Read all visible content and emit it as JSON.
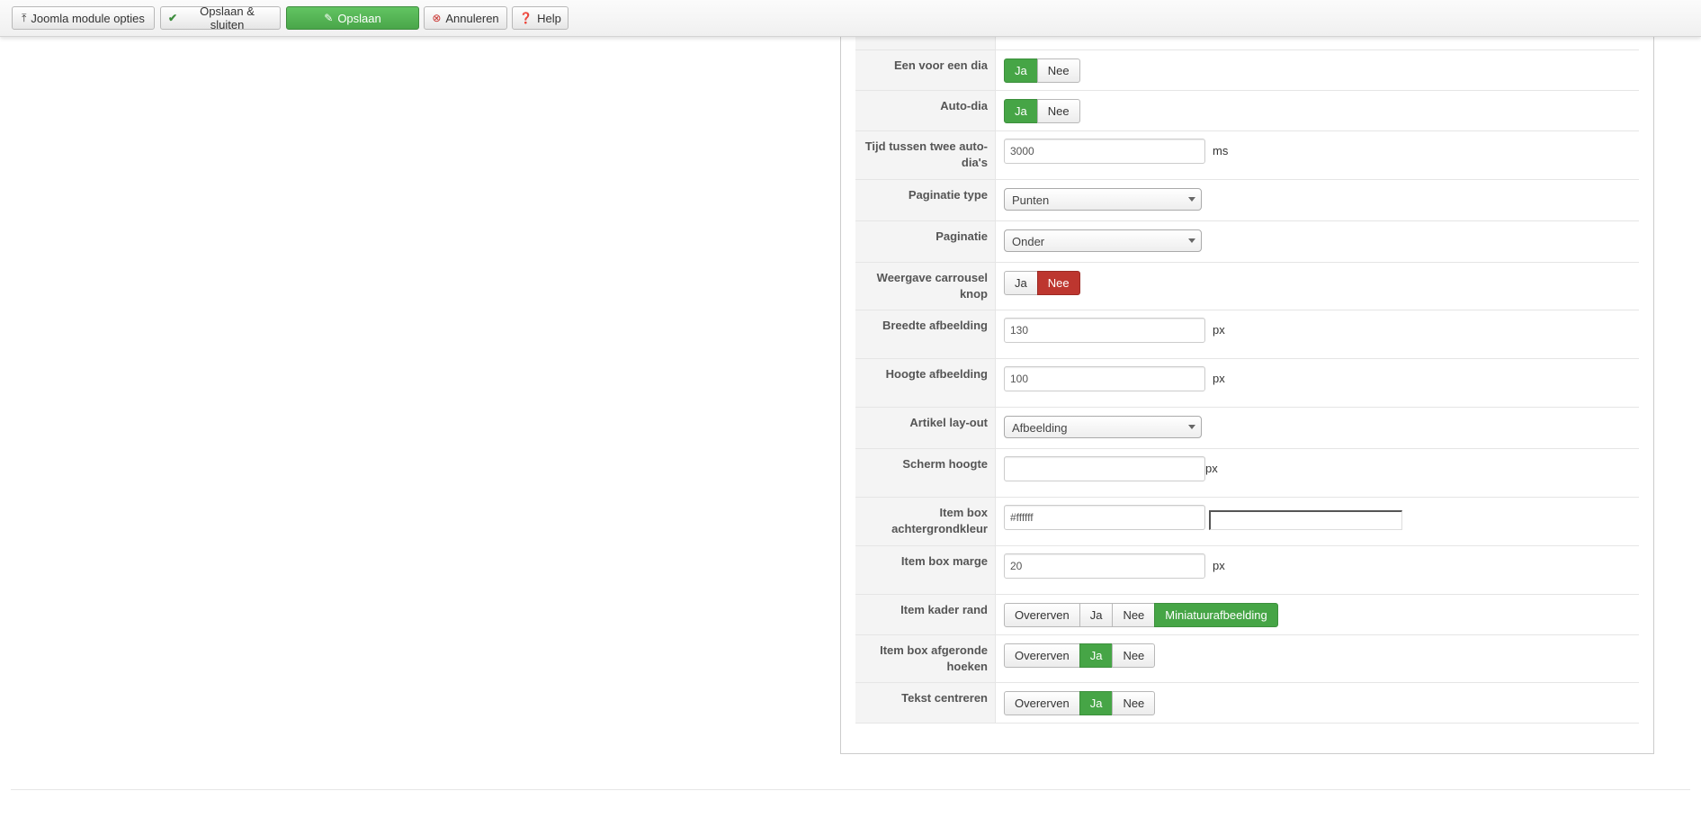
{
  "toolbar": {
    "buttons": [
      {
        "label": "Joomla module opties",
        "icon": "upload-icon"
      },
      {
        "label": "Opslaan & sluiten",
        "icon": "check-icon"
      },
      {
        "label": "Opslaan",
        "icon": "edit-icon"
      },
      {
        "label": "Annuleren",
        "icon": "cancel-icon"
      },
      {
        "label": "Help",
        "icon": "help-icon"
      }
    ]
  },
  "colors": {
    "toggle_on_green": "#46a546",
    "toggle_on_red": "#bd362f",
    "save_green": "#5bb75b"
  },
  "form": {
    "een_voor_een_dia": {
      "label": "Een voor een dia",
      "options": [
        "Ja",
        "Nee"
      ],
      "selected": "Ja"
    },
    "auto_dia": {
      "label": "Auto-dia",
      "options": [
        "Ja",
        "Nee"
      ],
      "selected": "Ja"
    },
    "tijd_tussen": {
      "label": "Tijd tussen twee auto-dia's",
      "value": "3000",
      "unit": "ms"
    },
    "paginatie_type": {
      "label": "Paginatie type",
      "value": "Punten"
    },
    "paginatie": {
      "label": "Paginatie",
      "value": "Onder"
    },
    "weergave_carrousel": {
      "label": "Weergave carrousel knop",
      "options": [
        "Ja",
        "Nee"
      ],
      "selected": "Nee"
    },
    "breedte_afbeelding": {
      "label": "Breedte afbeelding",
      "value": "130",
      "unit": "px"
    },
    "hoogte_afbeelding": {
      "label": "Hoogte afbeelding",
      "value": "100",
      "unit": "px"
    },
    "artikel_layout": {
      "label": "Artikel lay-out",
      "value": "Afbeelding"
    },
    "scherm_hoogte": {
      "label": "Scherm hoogte",
      "value": "",
      "unit": "px"
    },
    "item_box_achtergrondkleur": {
      "label": "Item box achtergrondkleur",
      "value": "#ffffff"
    },
    "item_box_marge": {
      "label": "Item box marge",
      "value": "20",
      "unit": "px"
    },
    "item_kader_rand": {
      "label": "Item kader rand",
      "options": [
        "Overerven",
        "Ja",
        "Nee",
        "Miniatuurafbeelding"
      ],
      "selected": "Miniatuurafbeelding"
    },
    "item_box_afgeronde_hoeken": {
      "label": "Item box afgeronde hoeken",
      "options": [
        "Overerven",
        "Ja",
        "Nee"
      ],
      "selected": "Ja"
    },
    "tekst_centreren": {
      "label": "Tekst centreren",
      "options": [
        "Overerven",
        "Ja",
        "Nee"
      ],
      "selected": "Ja"
    }
  }
}
